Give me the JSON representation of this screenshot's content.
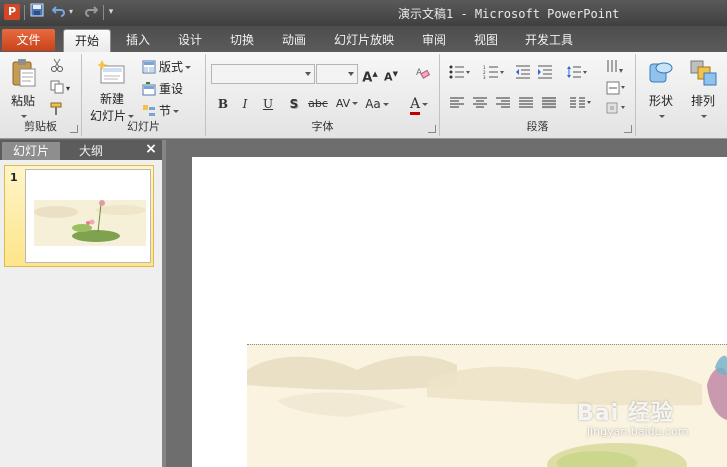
{
  "window": {
    "title": "演示文稿1 - Microsoft PowerPoint",
    "app_icon_letter": "P"
  },
  "tabs": {
    "file": "文件",
    "items": [
      "开始",
      "插入",
      "设计",
      "切换",
      "动画",
      "幻灯片放映",
      "审阅",
      "视图",
      "开发工具"
    ],
    "active": "开始"
  },
  "ribbon": {
    "clipboard": {
      "paste_label": "粘贴",
      "group_label": "剪贴板"
    },
    "slides": {
      "new_slide_label_line1": "新建",
      "new_slide_label_line2": "幻灯片",
      "layout_label": "版式",
      "reset_label": "重设",
      "section_label": "节",
      "group_label": "幻灯片"
    },
    "font": {
      "font_name_value": "",
      "font_size_value": "",
      "bold_label": "B",
      "italic_label": "I",
      "underline_label": "U",
      "shadow_label": "S",
      "strikethrough_label": "abc",
      "char_spacing_label": "AV",
      "change_case_label": "Aa",
      "font_color_label": "A",
      "grow_font_label": "A",
      "shrink_font_label": "A",
      "group_label": "字体"
    },
    "paragraph": {
      "group_label": "段落"
    },
    "drawing": {
      "shapes_label": "形状",
      "arrange_label": "排列"
    }
  },
  "left_pane": {
    "tab_slides": "幻灯片",
    "tab_outline": "大纲",
    "close_symbol": "×",
    "slides": [
      {
        "number": "1"
      }
    ]
  },
  "slide_content": {
    "watermark_text": "Bai 经验",
    "watermark_url": "jingyan.baidu.com"
  },
  "colors": {
    "file_tab": "#d24726",
    "title_bar": "#4a4a4a",
    "ribbon_bg": "#efefef",
    "selected_thumb": "#fde58a"
  }
}
